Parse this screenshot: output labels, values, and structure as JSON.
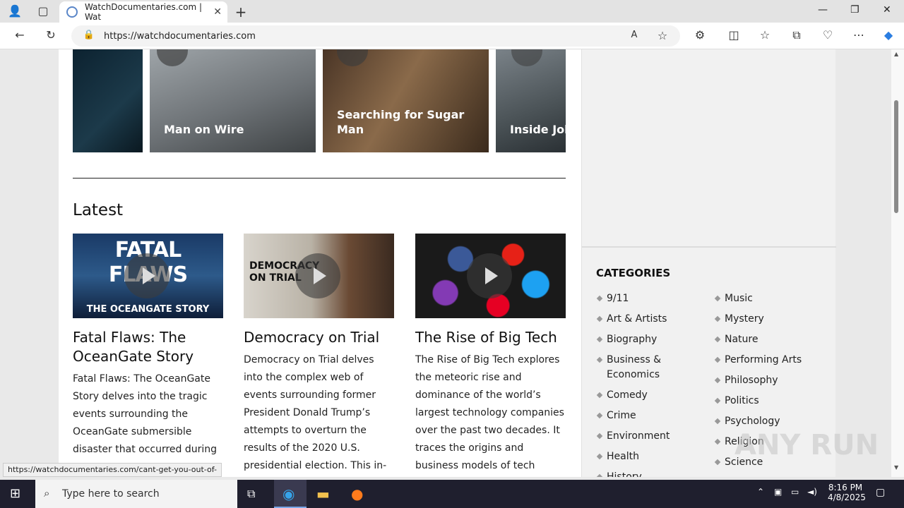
{
  "browser": {
    "tab_title": "WatchDocumentaries.com | Wat",
    "url": "https://watchdocumentaries.com",
    "status_url": "https://watchdocumentaries.com/cant-get-you-out-of-"
  },
  "carousel": [
    {
      "title": ""
    },
    {
      "title": "Man on Wire"
    },
    {
      "title": "Searching for Sugar Man"
    },
    {
      "title": "Inside Job"
    }
  ],
  "latest": {
    "heading": "Latest",
    "cards": [
      {
        "img_text": "FATAL FLAWS",
        "img_sub": "THE OCEANGATE STORY",
        "title": "Fatal Flaws: The OceanGate Story",
        "desc": "Fatal Flaws: The OceanGate Story delves into the tragic events surrounding the OceanGate submersible disaster that occurred during"
      },
      {
        "img_text": "DEMOCRACY ON TRIAL",
        "img_sub": "",
        "title": "Democracy on Trial",
        "desc": "Democracy on Trial delves into the complex web of events surrounding former President Donald Trump’s attempts to overturn the results of the 2020 U.S. presidential election. This in-"
      },
      {
        "img_text": "",
        "img_sub": "",
        "title": "The Rise of Big Tech",
        "desc": "The Rise of Big Tech explores the meteoric rise and dominance of the world’s largest technology companies over the past two decades. It traces the origins and business models of tech"
      }
    ]
  },
  "sidebar": {
    "categories_title": "CATEGORIES",
    "col1": [
      "9/11",
      "Art & Artists",
      "Biography",
      "Business & Economics",
      "Comedy",
      "Crime",
      "Environment",
      "Health",
      "History"
    ],
    "col2": [
      "Music",
      "Mystery",
      "Nature",
      "Performing Arts",
      "Philosophy",
      "Politics",
      "Psychology",
      "Religion",
      "Science"
    ]
  },
  "taskbar": {
    "search_placeholder": "Type here to search",
    "time": "8:16 PM",
    "date": "4/8/2025"
  },
  "watermark": "ANY RUN"
}
